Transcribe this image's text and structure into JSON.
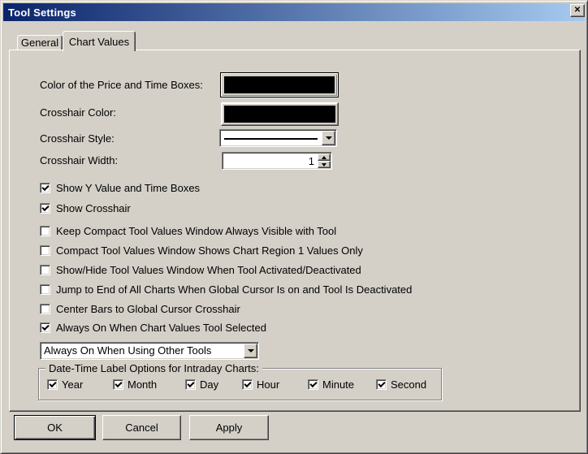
{
  "window": {
    "title": "Tool Settings"
  },
  "icons": {
    "close": "✕"
  },
  "tabs": [
    {
      "label": "General",
      "active": false
    },
    {
      "label": "Chart Values",
      "active": true
    }
  ],
  "settings": {
    "price_time_boxes_color_label": "Color of the Price and Time Boxes:",
    "price_time_boxes_color": "#000000",
    "crosshair_color_label": "Crosshair Color:",
    "crosshair_color": "#000000",
    "crosshair_style_label": "Crosshair Style:",
    "crosshair_style_selected": "solid-line",
    "crosshair_width_label": "Crosshair Width:",
    "crosshair_width_value": "1"
  },
  "checkboxes": [
    {
      "label": "Show Y Value and Time Boxes",
      "checked": true
    },
    {
      "label": "Show Crosshair",
      "checked": true
    },
    {
      "label": "Keep Compact Tool Values Window Always Visible with Tool",
      "checked": false
    },
    {
      "label": "Compact Tool Values Window Shows Chart Region 1 Values Only",
      "checked": false
    },
    {
      "label": "Show/Hide Tool Values Window When Tool Activated/Deactivated",
      "checked": false
    },
    {
      "label": "Jump to End of All Charts When Global Cursor Is on and Tool Is Deactivated",
      "checked": false
    },
    {
      "label": "Center Bars to Global Cursor Crosshair",
      "checked": false
    },
    {
      "label": "Always On When Chart Values Tool Selected",
      "checked": true
    }
  ],
  "other_tools_dropdown": {
    "value": "Always On When Using Other Tools"
  },
  "datetime_group": {
    "label": "Date-Time Label Options for Intraday Charts:",
    "options": [
      {
        "label": "Year",
        "checked": true
      },
      {
        "label": "Month",
        "checked": true
      },
      {
        "label": "Day",
        "checked": true
      },
      {
        "label": "Hour",
        "checked": true
      },
      {
        "label": "Minute",
        "checked": true
      },
      {
        "label": "Second",
        "checked": true
      }
    ]
  },
  "buttons": [
    {
      "label": "OK"
    },
    {
      "label": "Cancel"
    },
    {
      "label": "Apply"
    }
  ],
  "colors": {
    "dialog_bg": "#d4d0c8",
    "titlebar_gradient_start": "#0a246a",
    "titlebar_gradient_end": "#a6caf0",
    "swatch_black": "#000000"
  }
}
